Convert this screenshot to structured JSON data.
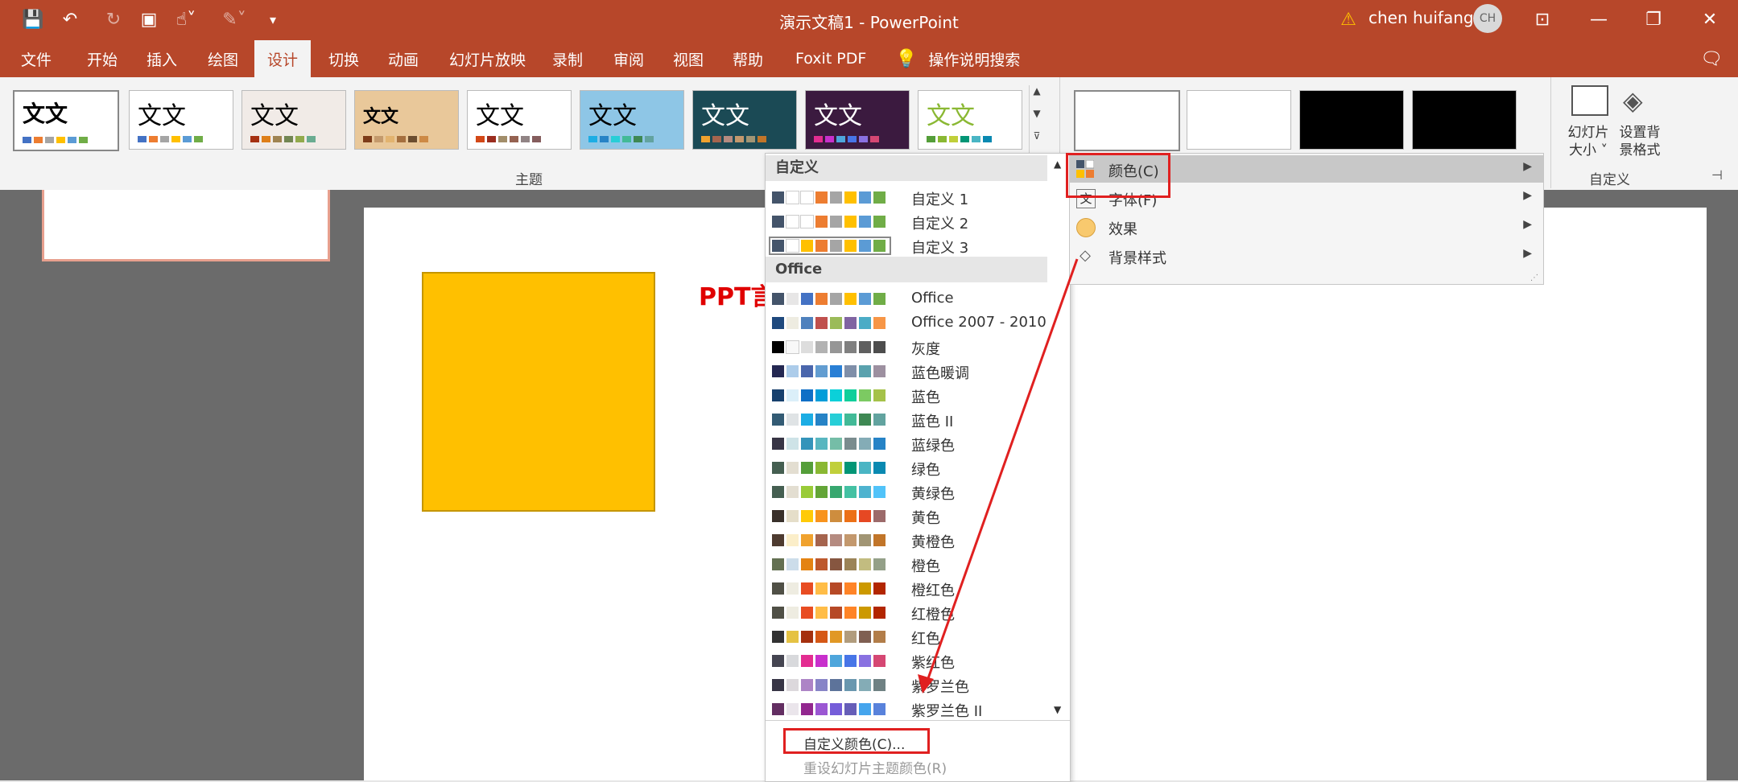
{
  "window": {
    "title": "演示文稿1  -  PowerPoint",
    "user": "chen huifang",
    "avatar_initials": "CH"
  },
  "menu": [
    "文件",
    "开始",
    "插入",
    "绘图",
    "设计",
    "切换",
    "动画",
    "幻灯片放映",
    "录制",
    "审阅",
    "视图",
    "帮助",
    "Foxit PDF",
    "操作说明搜索"
  ],
  "ribbon": {
    "themes_group_label": "主题",
    "theme_sample_text": "文文",
    "customize_group_label": "自定义",
    "slide_size_label": "幻灯片\n大小 ˅",
    "format_bg_label": "设置背\n景格式"
  },
  "color_dropdown": {
    "section_custom": "自定义",
    "custom_items": [
      {
        "name": "自定义 1",
        "colors": [
          "#44546a",
          "#ffffff",
          "#ffffff",
          "#ed7d31",
          "#a5a5a5",
          "#ffc000",
          "#5b9bd5",
          "#70ad47"
        ]
      },
      {
        "name": "自定义 2",
        "colors": [
          "#44546a",
          "#ffffff",
          "#ffffff",
          "#ed7d31",
          "#a5a5a5",
          "#ffc000",
          "#5b9bd5",
          "#70ad47"
        ]
      },
      {
        "name": "自定义 3",
        "colors": [
          "#44546a",
          "#ffffff",
          "#ffc000",
          "#ed7d31",
          "#a5a5a5",
          "#ffc000",
          "#5b9bd5",
          "#70ad47"
        ]
      }
    ],
    "section_office": "Office",
    "office_items": [
      {
        "name": "Office",
        "colors": [
          "#44546a",
          "#e7e6e6",
          "#4472c4",
          "#ed7d31",
          "#a5a5a5",
          "#ffc000",
          "#5b9bd5",
          "#70ad47"
        ]
      },
      {
        "name": "Office 2007 - 2010",
        "colors": [
          "#1f497d",
          "#eeece1",
          "#4f81bd",
          "#c0504d",
          "#9bbb59",
          "#8064a2",
          "#4bacc6",
          "#f79646"
        ]
      },
      {
        "name": "灰度",
        "colors": [
          "#000000",
          "#f8f8f8",
          "#dddddd",
          "#b2b2b2",
          "#969696",
          "#808080",
          "#5f5f5f",
          "#4d4d4d"
        ]
      },
      {
        "name": "蓝色暖调",
        "colors": [
          "#242852",
          "#acccea",
          "#4a66ac",
          "#629dd1",
          "#297fd5",
          "#7f8fa9",
          "#5aa2ae",
          "#9d90a0"
        ]
      },
      {
        "name": "蓝色",
        "colors": [
          "#17406d",
          "#dbeff9",
          "#0f6fc6",
          "#009dd9",
          "#0bd0d9",
          "#10cf9b",
          "#7cca62",
          "#a5c249"
        ]
      },
      {
        "name": "蓝色 II",
        "colors": [
          "#335b74",
          "#dfe3e5",
          "#1cade4",
          "#2683c6",
          "#27ced7",
          "#42ba97",
          "#3e8853",
          "#62a39f"
        ]
      },
      {
        "name": "蓝绿色",
        "colors": [
          "#373545",
          "#cee3e7",
          "#3494ba",
          "#58b6c0",
          "#75bda7",
          "#7a8c8e",
          "#84acb6",
          "#2683c6"
        ]
      },
      {
        "name": "绿色",
        "colors": [
          "#455f51",
          "#e3ded1",
          "#549e39",
          "#8ab833",
          "#c0cf3a",
          "#029676",
          "#4ab5c4",
          "#0989b1"
        ]
      },
      {
        "name": "黄绿色",
        "colors": [
          "#455f51",
          "#e3ded1",
          "#99cb38",
          "#63a537",
          "#37a76f",
          "#44c1a3",
          "#4eb3cf",
          "#51c3f9"
        ]
      },
      {
        "name": "黄色",
        "colors": [
          "#39302a",
          "#e5dec9",
          "#ffca08",
          "#f8931d",
          "#ce8d3e",
          "#ec7016",
          "#e64823",
          "#9c6a6a"
        ]
      },
      {
        "name": "黄橙色",
        "colors": [
          "#4e3b30",
          "#fbeec9",
          "#f0a22e",
          "#a5644e",
          "#b58b80",
          "#c3986d",
          "#a19574",
          "#c17529"
        ]
      },
      {
        "name": "橙色",
        "colors": [
          "#637052",
          "#ccddea",
          "#e48312",
          "#bd582c",
          "#865640",
          "#9b8357",
          "#c2bc80",
          "#94a088"
        ]
      },
      {
        "name": "橙红色",
        "colors": [
          "#505046",
          "#eeece1",
          "#e84c22",
          "#ffbd47",
          "#b64926",
          "#ff8427",
          "#cc9900",
          "#b22600"
        ]
      },
      {
        "name": "红橙色",
        "colors": [
          "#505046",
          "#eeece1",
          "#e84c22",
          "#ffbd47",
          "#b64926",
          "#ff8427",
          "#cc9900",
          "#b22600"
        ]
      },
      {
        "name": "红色",
        "colors": [
          "#323232",
          "#e5c243",
          "#a5300f",
          "#d55816",
          "#e19825",
          "#b19c7d",
          "#7f5f52",
          "#b27d49"
        ]
      },
      {
        "name": "紫红色",
        "colors": [
          "#454551",
          "#d8d9dc",
          "#e32d91",
          "#c830cc",
          "#4ea6dc",
          "#4775e7",
          "#8971e1",
          "#d54773"
        ]
      },
      {
        "name": "紫罗兰色",
        "colors": [
          "#373545",
          "#dcd8dc",
          "#ad84c6",
          "#8784c7",
          "#5d739a",
          "#6997af",
          "#84acb6",
          "#6f8183"
        ]
      },
      {
        "name": "紫罗兰色 II",
        "colors": [
          "#632e62",
          "#eae5eb",
          "#92278f",
          "#9b57d3",
          "#755dd9",
          "#665eb8",
          "#45a5ed",
          "#5982db"
        ]
      }
    ],
    "custom_colors": "自定义颜色(C)...",
    "reset_colors": "重设幻灯片主题颜色(R)"
  },
  "submenu": [
    {
      "label": "颜色(C)",
      "icon": "palette-icon"
    },
    {
      "label": "字体(F)",
      "icon": "font-icon"
    },
    {
      "label": "效果",
      "icon": "effects-icon"
    },
    {
      "label": "背景样式",
      "icon": "bucket-icon"
    }
  ],
  "slide": {
    "text": "PPT言"
  },
  "colors": {
    "accent": "#b7472a",
    "highlight_red": "#e02020"
  }
}
